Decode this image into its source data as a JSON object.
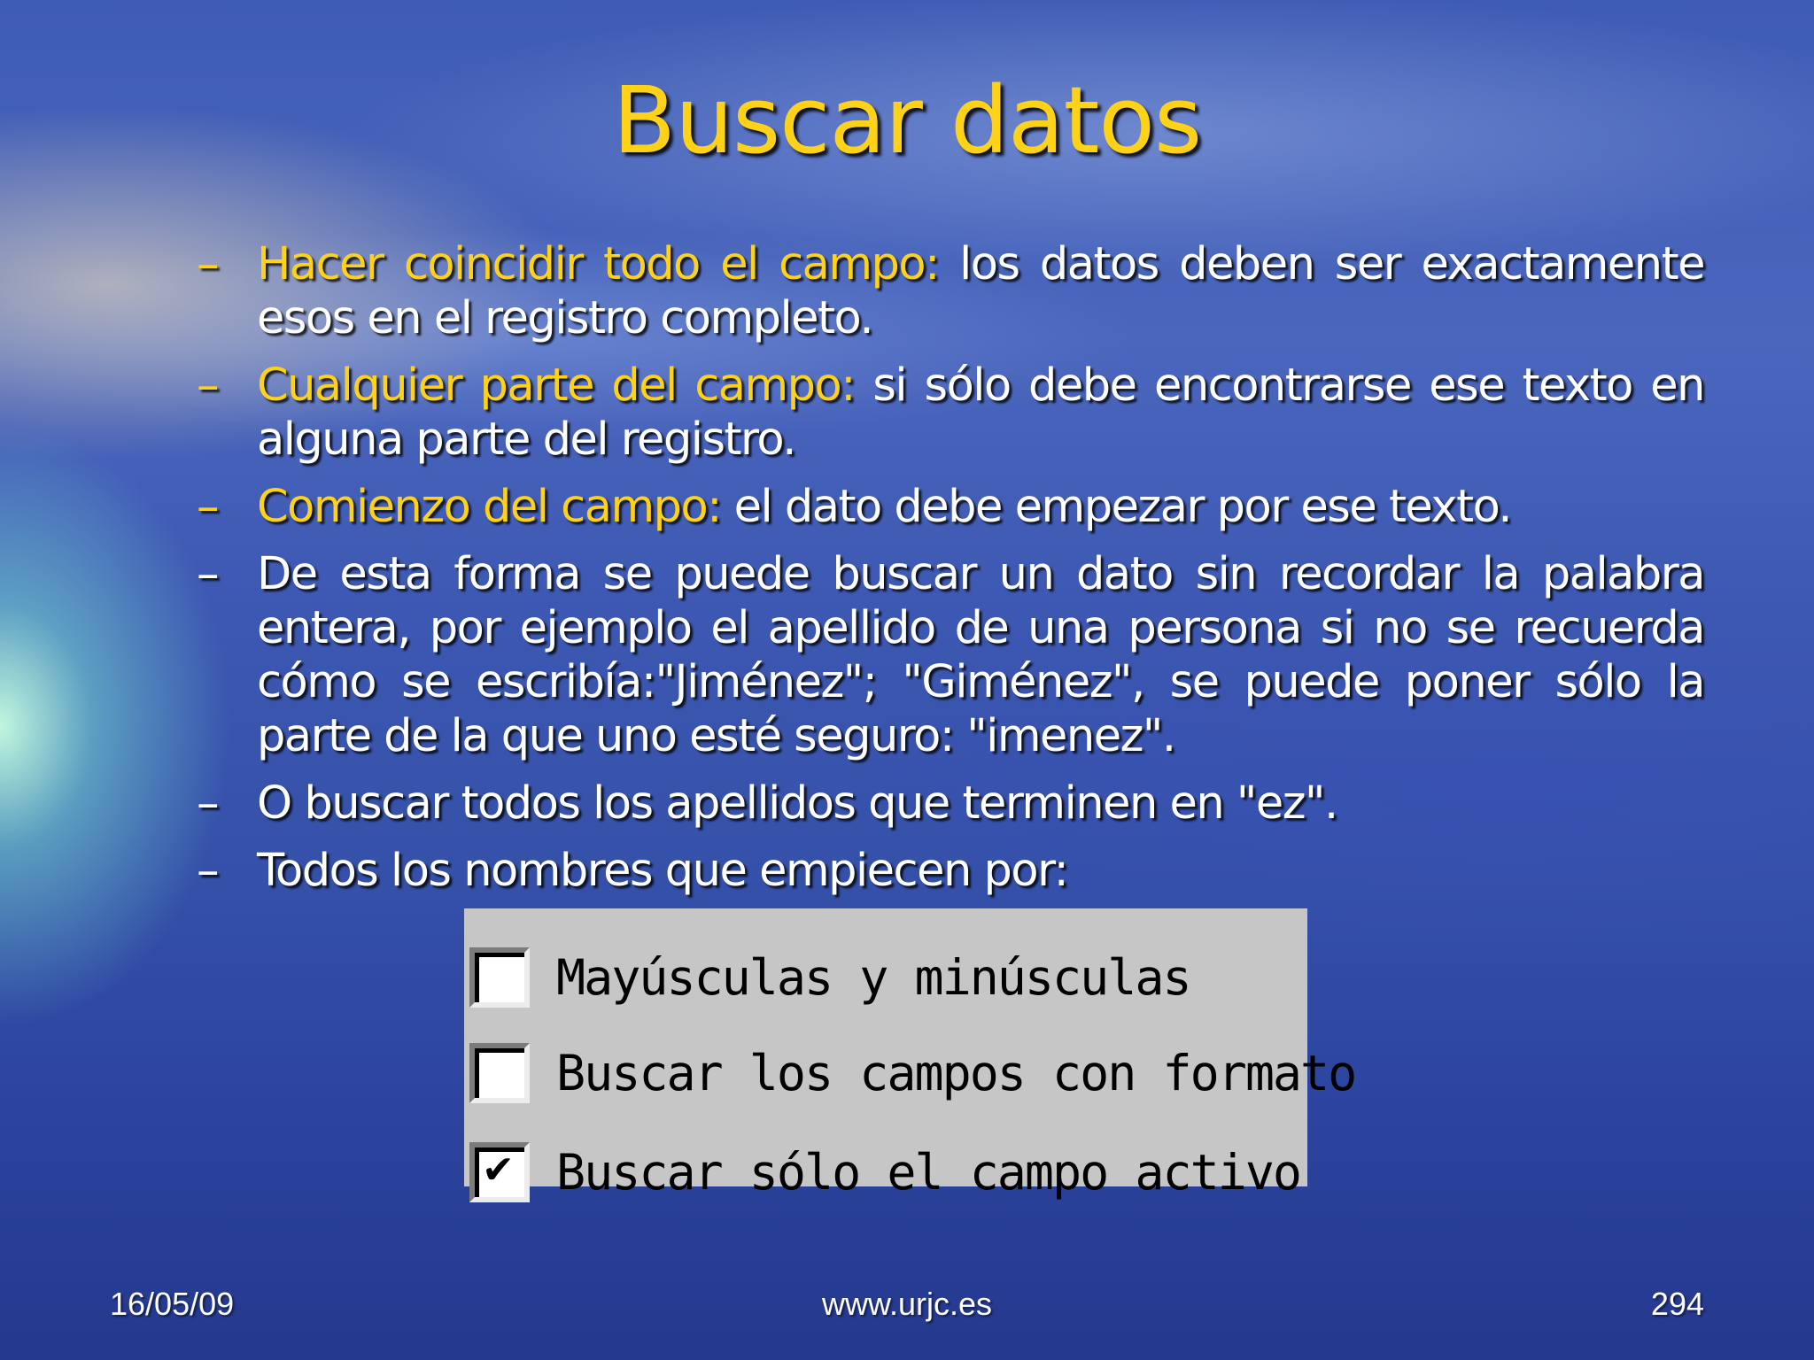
{
  "slide": {
    "title": "Buscar datos"
  },
  "bullets": [
    {
      "dash": "–",
      "highlight": "Hacer coincidir todo el campo:",
      "text": " los datos deben ser exactamente esos en el registro completo."
    },
    {
      "dash": "–",
      "highlight": "Cualquier parte del campo:",
      "text": " si sólo debe encontrarse ese texto en alguna parte del registro."
    },
    {
      "dash": "–",
      "highlight": "Comienzo del campo:",
      "text": " el dato debe empezar por ese texto."
    },
    {
      "dash": "–",
      "highlight": "",
      "text": "De esta forma se puede buscar un dato sin recordar la palabra entera, por ejemplo el apellido de una persona si no se recuerda cómo se escribía:\"Jiménez\"; \"Giménez\", se puede poner sólo la parte de la que uno esté seguro: \"imenez\"."
    },
    {
      "dash": "–",
      "highlight": "",
      "text": "O buscar todos los apellidos que terminen en \"ez\"."
    },
    {
      "dash": "–",
      "highlight": "",
      "text": "Todos los nombres que empiecen por:"
    }
  ],
  "options": [
    {
      "label": "Mayúsculas y minúsculas",
      "checked": false
    },
    {
      "label": "Buscar los campos con formato",
      "checked": false
    },
    {
      "label": "Buscar sólo el campo activo",
      "checked": true,
      "check_mark": "✔"
    }
  ],
  "footer": {
    "date": "16/05/09",
    "url": "www.urjc.es",
    "page": "294"
  },
  "colors": {
    "title": "#ffd21a",
    "highlight": "#ffd21a",
    "text": "#ffffff",
    "panel": "#c6c6c6"
  }
}
